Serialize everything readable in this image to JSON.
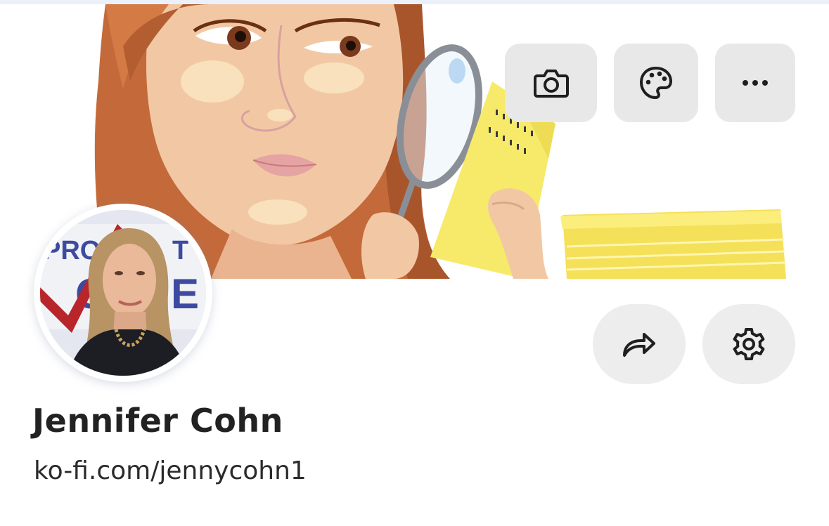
{
  "profile": {
    "name": "Jennifer Cohn",
    "url": "ko-fi.com/jennycohn1"
  },
  "cover_actions": [
    {
      "id": "camera",
      "icon": "camera-icon"
    },
    {
      "id": "theme",
      "icon": "palette-icon"
    },
    {
      "id": "more",
      "icon": "more-horizontal-icon"
    }
  ],
  "profile_actions": [
    {
      "id": "share",
      "icon": "share-arrow-icon"
    },
    {
      "id": "settings",
      "icon": "gear-icon"
    }
  ],
  "avatar": {
    "background_sign_text": "PROJECT VOTE",
    "sign_letters_visible": "PRO T O E"
  },
  "colors": {
    "button_bg": "#e8e8e8",
    "text_primary": "#222222",
    "cover_hair": "#c8703f",
    "cover_paper": "#f7ea6a"
  }
}
